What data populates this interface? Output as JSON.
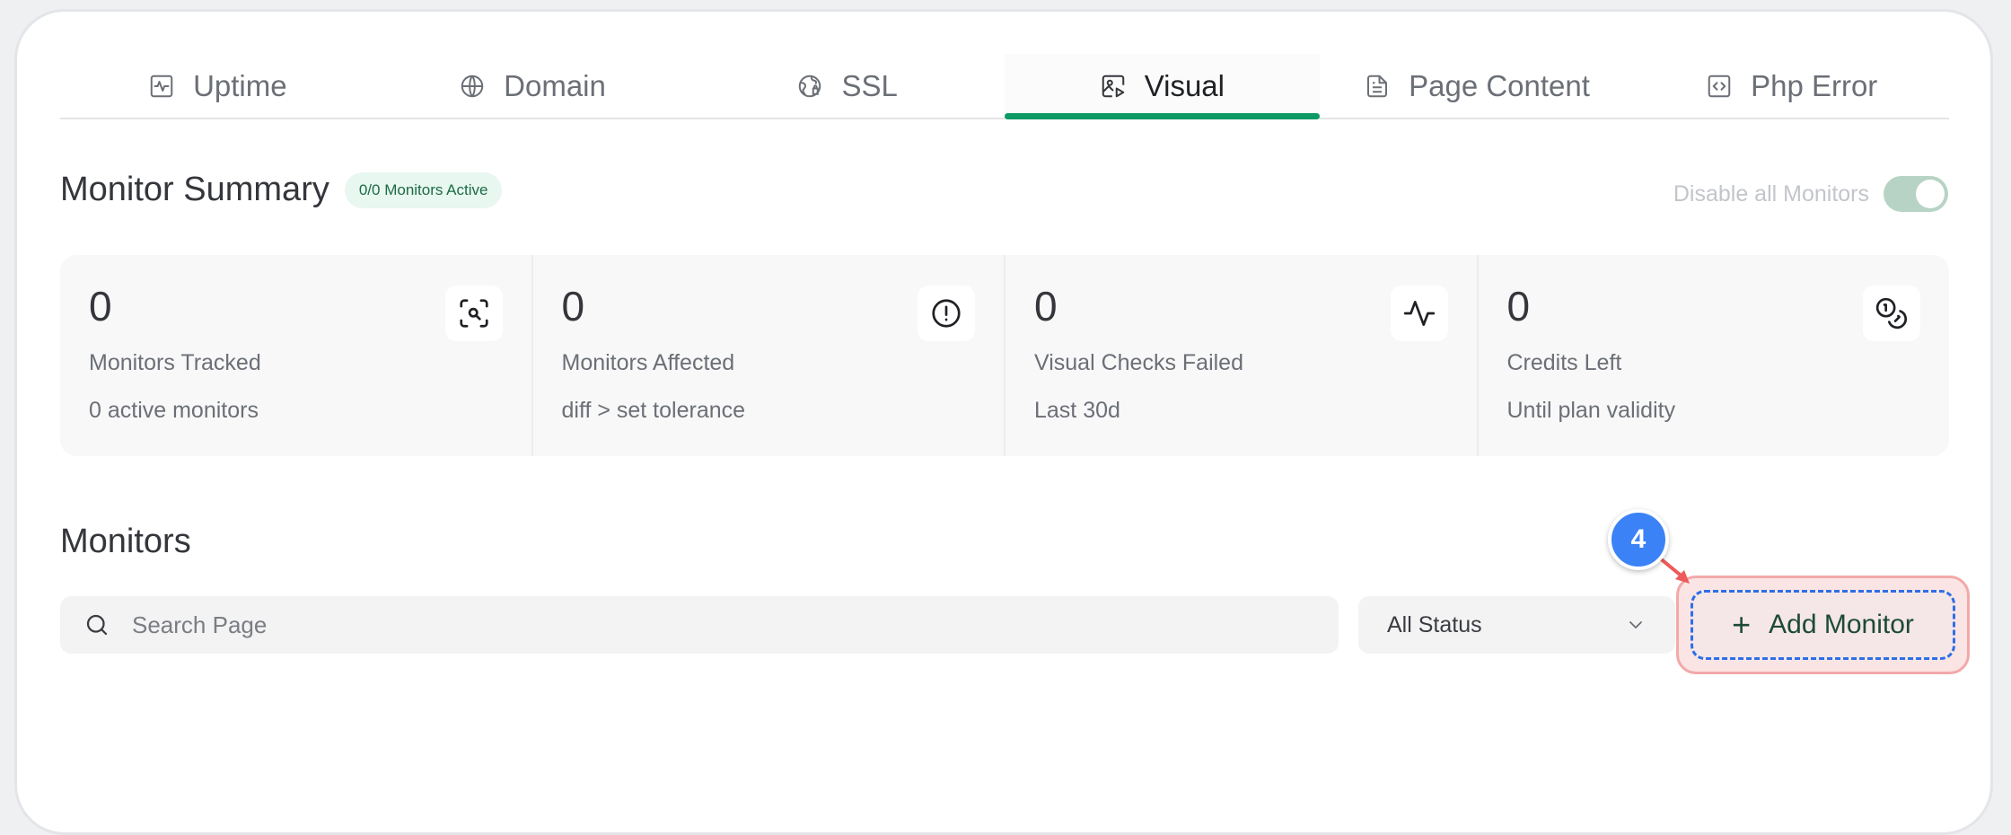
{
  "tabs": [
    {
      "label": "Uptime",
      "icon": "uptime-icon"
    },
    {
      "label": "Domain",
      "icon": "globe-icon"
    },
    {
      "label": "SSL",
      "icon": "ssl-globe-icon"
    },
    {
      "label": "Visual",
      "icon": "image-play-icon",
      "active": true
    },
    {
      "label": "Page Content",
      "icon": "document-icon"
    },
    {
      "label": "Php Error",
      "icon": "code-file-icon"
    }
  ],
  "summary": {
    "title": "Monitor Summary",
    "badge": "0/0 Monitors Active",
    "toggle_label": "Disable all Monitors",
    "toggle_on": true
  },
  "stats": [
    {
      "value": "0",
      "label": "Monitors Tracked",
      "sub": "0 active monitors",
      "icon": "scan-search-icon"
    },
    {
      "value": "0",
      "label": "Monitors Affected",
      "sub": "diff > set tolerance",
      "icon": "alert-circle-icon"
    },
    {
      "value": "0",
      "label": "Visual Checks Failed",
      "sub": "Last 30d",
      "icon": "activity-icon"
    },
    {
      "value": "0",
      "label": "Credits Left",
      "sub": "Until plan validity",
      "icon": "coins-icon"
    }
  ],
  "monitors": {
    "title": "Monitors",
    "search_placeholder": "Search Page",
    "status_selected": "All Status",
    "add_button": "Add Monitor",
    "step_number": "4"
  },
  "colors": {
    "accent": "#0e9a64",
    "highlight_border": "#f2a9a9",
    "step_badge": "#3b82f6"
  }
}
